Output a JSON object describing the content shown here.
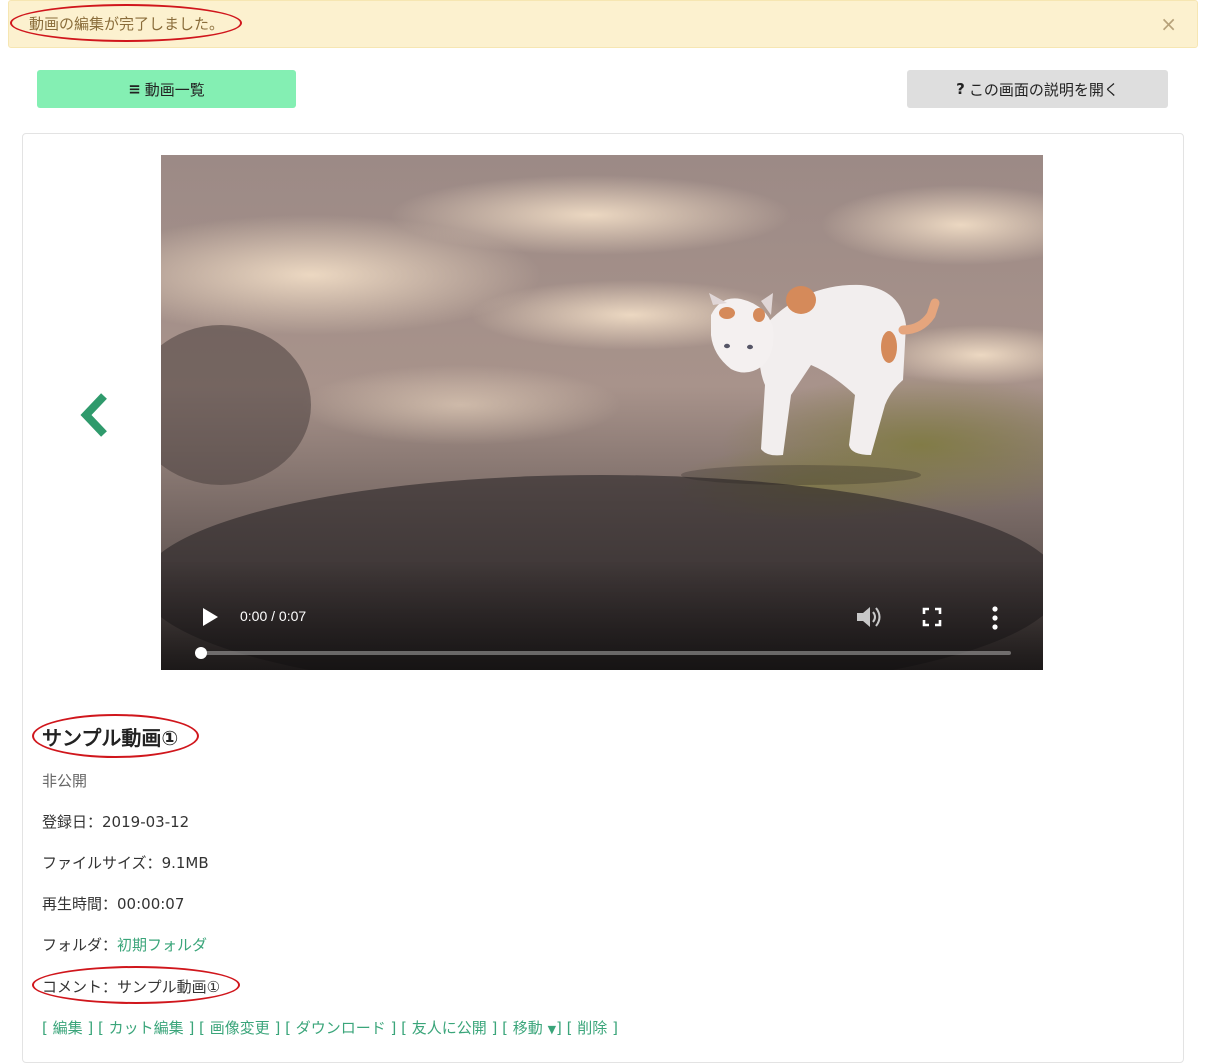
{
  "alert": {
    "message": "動画の編集が完了しました。",
    "close_symbol": "×"
  },
  "toolbar": {
    "list_icon": "≡",
    "list_label": "動画一覧",
    "help_icon": "?",
    "help_label": "この画面の説明を開く"
  },
  "video": {
    "time_display": "0:00 / 0:07",
    "progress": 0
  },
  "details": {
    "title": "サンプル動画①",
    "status": "非公開",
    "registered_label": "登録日：",
    "registered_value": "2019-03-12",
    "filesize_label": "ファイルサイズ：",
    "filesize_value": "9.1MB",
    "duration_label": "再生時間：",
    "duration_value": "00:00:07",
    "folder_label": "フォルダ：",
    "folder_value": "初期フォルダ",
    "comment_label": "コメント：",
    "comment_value": "サンプル動画①"
  },
  "actions": {
    "edit": "編集",
    "cut_edit": "カット編集",
    "image_change": "画像変更",
    "download": "ダウンロード",
    "share_friends": "友人に公開",
    "move": "移動",
    "delete": "削除"
  },
  "colors": {
    "accent_green": "#3aa57a",
    "list_button": "#84efb3",
    "alert_bg": "#fcf1cf",
    "annotation_red": "#d0161c"
  }
}
